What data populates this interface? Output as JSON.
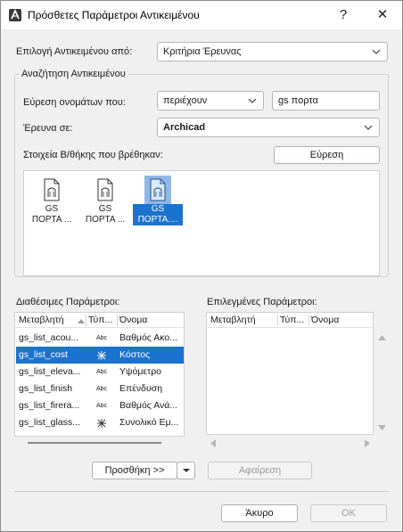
{
  "window": {
    "title": "Πρόσθετες Παράμετροι Αντικειμένου",
    "help_glyph": "?",
    "close_glyph": "✕"
  },
  "select_from": {
    "label": "Επιλογή Αντικειμένου από:",
    "value": "Κριτήρια Έρευνας"
  },
  "search": {
    "group_title": "Αναζήτηση Αντικειμένου",
    "find_names_label": "Εύρεση ονομάτων που:",
    "condition_value": "περιέχουν",
    "query_value": "gs πορτα",
    "search_in_label": "Έρευνα σε:",
    "search_in_value": "Archicad",
    "found_label": "Στοιχεία Β/θήκης που βρέθηκαν:",
    "find_button": "Εύρεση",
    "results": [
      {
        "line1": "GS",
        "line2": "ΠΟΡΤΑ ...",
        "selected": false
      },
      {
        "line1": "GS",
        "line2": "ΠΟΡΤΑ ...",
        "selected": false
      },
      {
        "line1": "GS",
        "line2": "ΠΟΡΤΑ....",
        "selected": true
      }
    ]
  },
  "available": {
    "label": "Διαθέσιμες Παράμετροι:",
    "columns": [
      "Μεταβλητή",
      "Τύπ...",
      "Όνομα"
    ],
    "rows": [
      {
        "variable": "gs_list_acou...",
        "type": "Abc",
        "name": "Βαθμός Ακο...",
        "selected": false
      },
      {
        "variable": "gs_list_cost",
        "type": "star",
        "name": "Κόστος",
        "selected": true
      },
      {
        "variable": "gs_list_eleva...",
        "type": "Abc",
        "name": "Υψόμετρο",
        "selected": false
      },
      {
        "variable": "gs_list_finish",
        "type": "Abc",
        "name": "Επένδυση",
        "selected": false
      },
      {
        "variable": "gs_list_firera...",
        "type": "Abc",
        "name": "Βαθμός Ανά...",
        "selected": false
      },
      {
        "variable": "gs_list_glass...",
        "type": "star",
        "name": "Συνολικό Εμ...",
        "selected": false
      }
    ]
  },
  "selected_params": {
    "label": "Επιλεγμένες Παράμετροι:",
    "columns": [
      "Μεταβλητή",
      "Τύπ...",
      "Όνομα"
    ]
  },
  "actions": {
    "add_label": "Προσθήκη >>",
    "remove_label": "Αφαίρεση",
    "cancel_label": "Άκυρο",
    "ok_label": "OK"
  }
}
